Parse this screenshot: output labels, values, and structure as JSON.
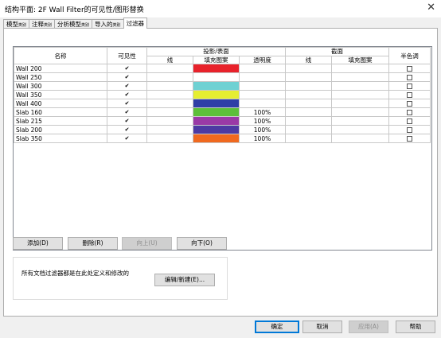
{
  "window": {
    "title": "结构平面: 2F Wall Filter的可见性/图形替换",
    "close_glyph": "✕"
  },
  "tabs": [
    {
      "label": "模型",
      "suffix": "类别"
    },
    {
      "label": "注释",
      "suffix": "类别"
    },
    {
      "label": "分析模型",
      "suffix": "类别"
    },
    {
      "label": "导入的",
      "suffix": "类别"
    },
    {
      "label": "过滤器",
      "suffix": ""
    }
  ],
  "active_tab": 4,
  "grid": {
    "headers": {
      "name": "名称",
      "visibility": "可见性",
      "projection": "投影/表面",
      "lines": "线",
      "fill_pattern": "填充图案",
      "transparency": "透明度",
      "cut": "截面",
      "cut_lines": "线",
      "cut_fill_pattern": "填充图案",
      "halftone": "半色调"
    },
    "rows": [
      {
        "name": "Wall 200",
        "visible": true,
        "color": "#e8222b",
        "transparency": "",
        "halftone": false
      },
      {
        "name": "Wall 250",
        "visible": true,
        "color": "#ffffff",
        "transparency": "",
        "halftone": false
      },
      {
        "name": "Wall 300",
        "visible": true,
        "color": "#6fd1d3",
        "transparency": "",
        "halftone": false
      },
      {
        "name": "Wall 350",
        "visible": true,
        "color": "#e6ee32",
        "transparency": "",
        "halftone": false
      },
      {
        "name": "Wall 400",
        "visible": true,
        "color": "#2f3fa6",
        "transparency": "",
        "halftone": false
      },
      {
        "name": "Slab 160",
        "visible": true,
        "color": "#5dbf3a",
        "transparency": "100%",
        "halftone": false
      },
      {
        "name": "Slab 215",
        "visible": true,
        "color": "#9a3aa6",
        "transparency": "100%",
        "halftone": false
      },
      {
        "name": "Slab 200",
        "visible": true,
        "color": "#4d3aa3",
        "transparency": "100%",
        "halftone": false
      },
      {
        "name": "Slab 350",
        "visible": true,
        "color": "#f0691f",
        "transparency": "100%",
        "halftone": false
      }
    ],
    "empty_rows": 11
  },
  "filter_buttons": {
    "add": "添加(D)",
    "remove": "删除(R)",
    "up": "向上(U)",
    "down": "向下(O)"
  },
  "info": {
    "text": "所有文档过滤器都是在此处定义和修改的",
    "edit_button": "编辑/新建(E)..."
  },
  "footer": {
    "ok": "确定",
    "cancel": "取消",
    "apply": "应用(A)",
    "help": "帮助"
  }
}
